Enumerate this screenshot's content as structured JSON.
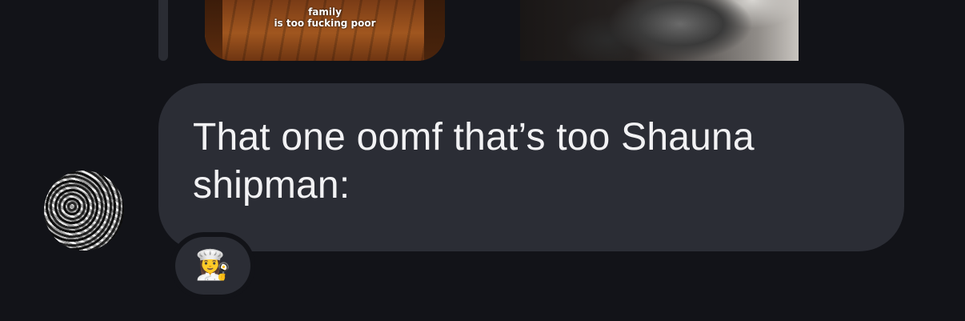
{
  "media": {
    "left_caption_line1": "family",
    "left_caption_line2": "is too fucking poor"
  },
  "message": {
    "text_line1": "That one oomf that’s too Shauna",
    "text_line2": "shipman:"
  },
  "reaction": {
    "emoji": "👩‍🍳"
  },
  "colors": {
    "background": "#121318",
    "bubble": "#2b2d35",
    "text": "#f2f2f4"
  }
}
